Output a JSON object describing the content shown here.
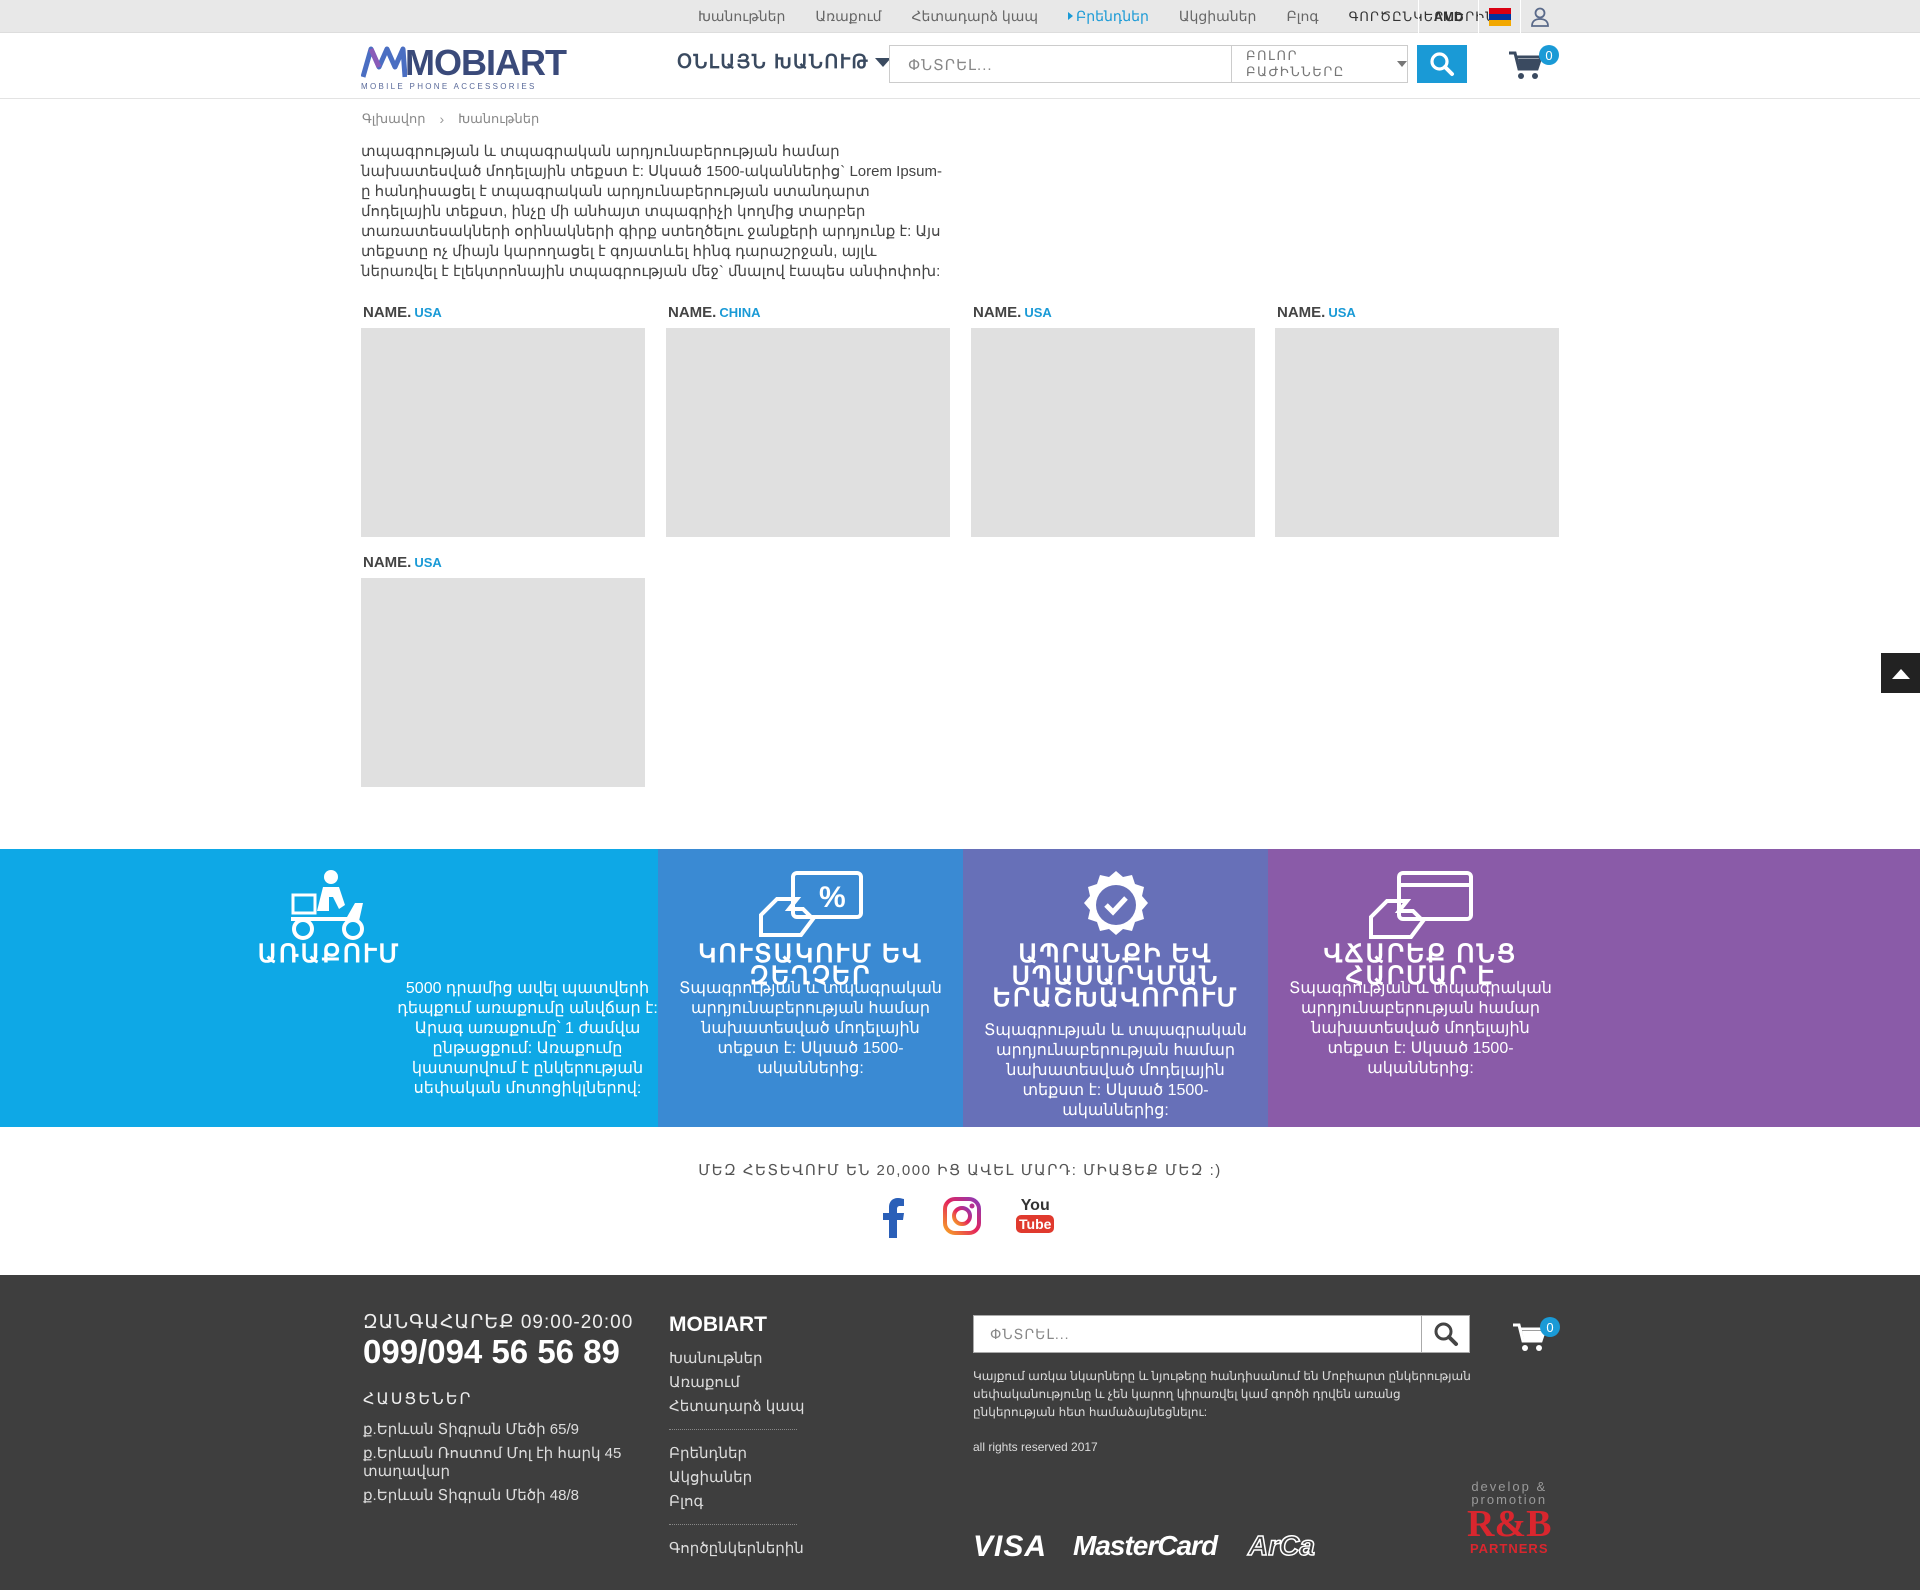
{
  "topbar": {
    "links": [
      "Խանութներ",
      "Առաքում",
      "Հետադարձ կապ",
      "Բրենդներ",
      "Ակցիաներ",
      "Բլոգ",
      "ԳՈՐԾԸՆԿԵՐՆԵՐԻՆ"
    ],
    "active_index": 3,
    "currency": "AMD",
    "flag_colors": [
      "#d90012",
      "#0033a0",
      "#f2a800"
    ]
  },
  "header": {
    "logo_text": "MOBIART",
    "logo_tagline": "MOBILE PHONE ACCESSORIES",
    "online_shop": "ՕՆԼԱՅՆ ԽԱՆՈՒԹ",
    "search_placeholder": "ՓՆՏՐԵԼ...",
    "category_label": "ԲՈԼՈՐ ԲԱԺԻՆՆԵՐԸ",
    "cart_count": "0",
    "accent": "#1a9ad6"
  },
  "breadcrumb": {
    "home": "Գլխավոր",
    "current": "Խանութներ"
  },
  "description": "տպագրության և տպագրական արդյունաբերության համար նախատեսված մոդելային տեքստ է: Սկսած 1500-ականներից` Lorem Ipsum-ը հանդիսացել է տպագրական արդյունաբերության ստանդարտ մոդելային տեքստ, ինչը մի անհայտ տպագրիչի կողմից տարբեր տառատեսակների օրինակների գիրք ստեղծելու ջանքերի արդյունք է: Այս տեքստը ոչ միայն կարողացել է գոյատևել հինգ դարաշրջան, այլև ներառվել է էլեկտրոնային տպագրության մեջ` մնալով էապես անփոփոխ:",
  "stores": [
    {
      "name": "NAME.",
      "country": "USA"
    },
    {
      "name": "NAME.",
      "country": "CHINA"
    },
    {
      "name": "NAME.",
      "country": "USA"
    },
    {
      "name": "NAME.",
      "country": "USA"
    },
    {
      "name": "NAME.",
      "country": "USA"
    }
  ],
  "features": [
    {
      "title": "ԱՌԱՔՈՒՄ",
      "text": "5000 դրամից ավել պատվերի դեպքում առաքումը անվճար է: Արագ առաքումը՝ 1 ժամվա ընթացքում: Առաքումը կատարվում է ընկերության սեփական մոտոցիկլներով:",
      "color": "#0ea8e6",
      "icon": "delivery-scooter-icon"
    },
    {
      "title": "ԿՈՒՏԱԿՈՒՄ ԵՎ ԶԵՂՉԵՐ",
      "text": "Տպագրության և տպագրական արդյունաբերության համար նախատեսված մոդելային տեքստ է: Սկսած 1500-ականներից:",
      "color": "#3a8ad3",
      "icon": "discount-card-icon"
    },
    {
      "title": "ԱՊՐԱՆՔԻ ԵՎ ՍՊԱՍԱՐԿՄԱՆ ԵՐԱՇԽԱՎՈՐՈՒՄ",
      "text": "Տպագրության և տպագրական արդյունաբերության համար նախատեսված մոդելային տեքստ է: Սկսած 1500-ականներից:",
      "color": "#6770b8",
      "icon": "guarantee-badge-icon"
    },
    {
      "title": "ՎՃԱՐԵՔ ՈՆՑ ՀԱՐՄԱՐ Է",
      "text": "Տպագրության և տպագրական արդյունաբերության համար նախատեսված մոդելային տեքստ է: Սկսած 1500-ականներից:",
      "color": "#8a5ba8",
      "icon": "card-payment-icon"
    }
  ],
  "social": {
    "follow_text": "ՄԵԶ ՀԵՏԵՎՈՒՄ ԵՆ 20,000 ԻՑ ԱՎԵԼ ՄԱՐԴ: ՄԻԱՑԵՔ ՄԵԶ :)",
    "youtube_top": "You",
    "youtube_bottom": "Tube"
  },
  "footer": {
    "call_label": "ԶԱՆԳԱՀԱՐԵՔ 09:00-20:00",
    "phone": "099/094 56 56 89",
    "addresses_title": "ՀԱՍՑԵՆԵՐ",
    "addresses": [
      "ք.Երևան Տիգրան Մեծի 65/9",
      "ք.Երևան Ռոստոմ Մոլ էի հարկ 45 տաղավար",
      "ք.Երևան Տիգրան Մեծի 48/8"
    ],
    "brand": "MOBIART",
    "links_group1": [
      "Խանութներ",
      "Առաքում",
      "Հետադարձ կապ"
    ],
    "links_group2": [
      "Բրենդներ",
      "Ակցիաներ",
      "Բլոգ"
    ],
    "links_group3": [
      "Գործընկերներին"
    ],
    "search_placeholder": "ՓՆՏՐԵԼ...",
    "cart_count": "0",
    "note": "Կայքում առկա նկարները և նյութերը հանդիսանում են Մոբիարտ ընկերության սեփականությունը և չեն կարող կիրառվել կամ գործի դրվեն առանց ընկերության հետ համաձայնեցնելու:",
    "rights": "all rights reserved 2017",
    "payments": [
      "VISA",
      "MasterCard",
      "ArCa"
    ],
    "dev_line1": "develop &",
    "dev_line2": "promotion",
    "dev_logo": "R&B",
    "dev_partners": "PARTNERS"
  }
}
